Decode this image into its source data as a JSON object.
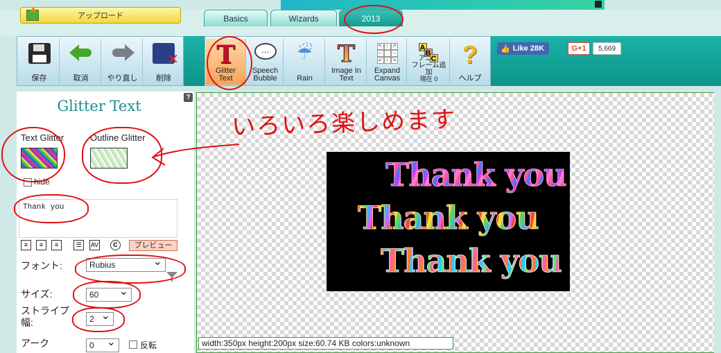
{
  "header": {
    "upload_label": "アップロード",
    "tabs": [
      {
        "label": "Basics"
      },
      {
        "label": "Wizards"
      },
      {
        "label": "2013"
      }
    ]
  },
  "toolbar": {
    "main": [
      {
        "label": "保存",
        "icon": "save-icon"
      },
      {
        "label": "取消",
        "icon": "undo-icon"
      },
      {
        "label": "やり直し",
        "icon": "redo-icon"
      },
      {
        "label": "削除",
        "icon": "delete-icon"
      }
    ],
    "effects": [
      {
        "label_line1": "Glitter",
        "label_line2": "Text",
        "icon": "glitter-text-icon"
      },
      {
        "label_line1": "Speech",
        "label_line2": "Bubble",
        "icon": "speech-bubble-icon"
      },
      {
        "label_line1": "Rain",
        "label_line2": "",
        "icon": "rain-icon"
      },
      {
        "label_line1": "Image In",
        "label_line2": "Text",
        "icon": "image-in-text-icon"
      },
      {
        "label_line1": "Expand",
        "label_line2": "Canvas",
        "icon": "expand-canvas-icon"
      },
      {
        "label_line1": "アニメ",
        "label_line2": "フレーム追加",
        "label_line3": "現在 0",
        "icon": "frame-add-icon"
      },
      {
        "label_line1": "ヘルプ",
        "label_line2": "",
        "icon": "help-icon"
      }
    ]
  },
  "social": {
    "fb_like_label": "Like 28K",
    "gplus_label": "G+1",
    "gplus_count": "5,669"
  },
  "panel": {
    "help_glyph": "?",
    "title": "Glitter Text",
    "text_glitter_label": "Text Glitter",
    "outline_glitter_label": "Outline Glitter",
    "hide_label": "hide",
    "text_value": "Thank you",
    "preview_label": "プレビュー",
    "font_label": "フォント:",
    "font_value": "Rubius",
    "size_label": "サイズ:",
    "size_value": "60",
    "stripe_label_line1": "ストライプ",
    "stripe_label_line2": "幅:",
    "stripe_value": "2",
    "arc_label": "アーク",
    "arc_value": "0",
    "reverse_label": "反転"
  },
  "canvas": {
    "lines": [
      "Thank you",
      "Thank you",
      "Thank you"
    ],
    "info": "width:350px  height:200px  size:60.74 KB  colors:unknown",
    "annotation_note": "いろいろ楽しめます"
  },
  "colors": {
    "accent": "#19b3a7",
    "annotation": "#e01010",
    "title": "#1f8c88"
  }
}
